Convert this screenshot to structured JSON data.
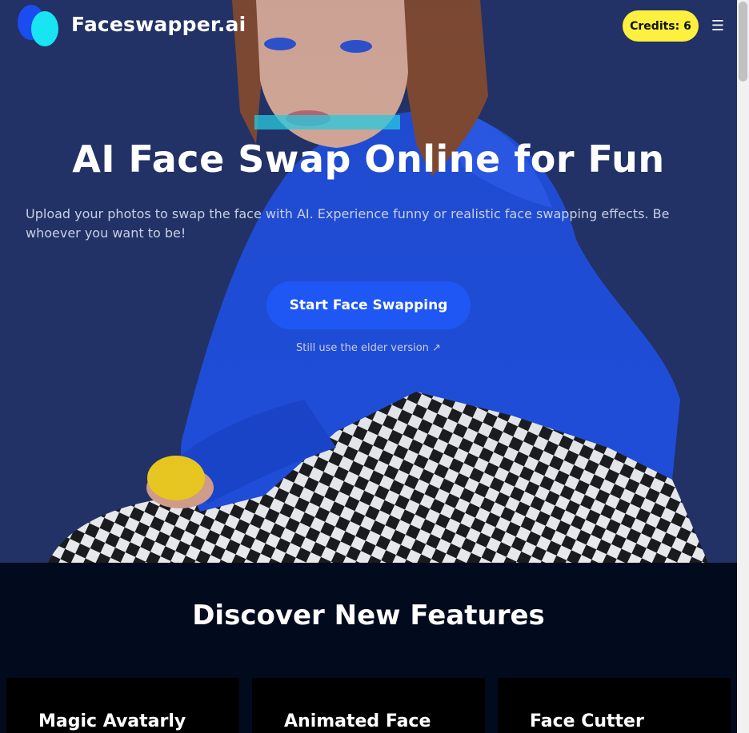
{
  "header": {
    "brand": "Faceswapper.ai",
    "credits_label": "Credits: 6",
    "menu_icon": "hamburger-menu-icon"
  },
  "hero": {
    "title": "AI Face Swap Online for Fun",
    "subtitle": "Upload your photos to swap the face with AI. Experience funny or realistic face swapping effects. Be whoever you want to be!",
    "cta_label": "Start Face Swapping",
    "elder_link": "Still use the elder version ↗"
  },
  "features": {
    "title": "Discover New Features",
    "cards": [
      {
        "title": "Magic Avatarly"
      },
      {
        "title": "Animated Face"
      },
      {
        "title": "Face Cutter"
      }
    ]
  },
  "colors": {
    "hero_bg": "#223266",
    "accent_blue": "#1f57f5",
    "credits_yellow": "#fdf03e",
    "logo_cyan": "#19e4f2",
    "page_dark": "#020a1e"
  }
}
